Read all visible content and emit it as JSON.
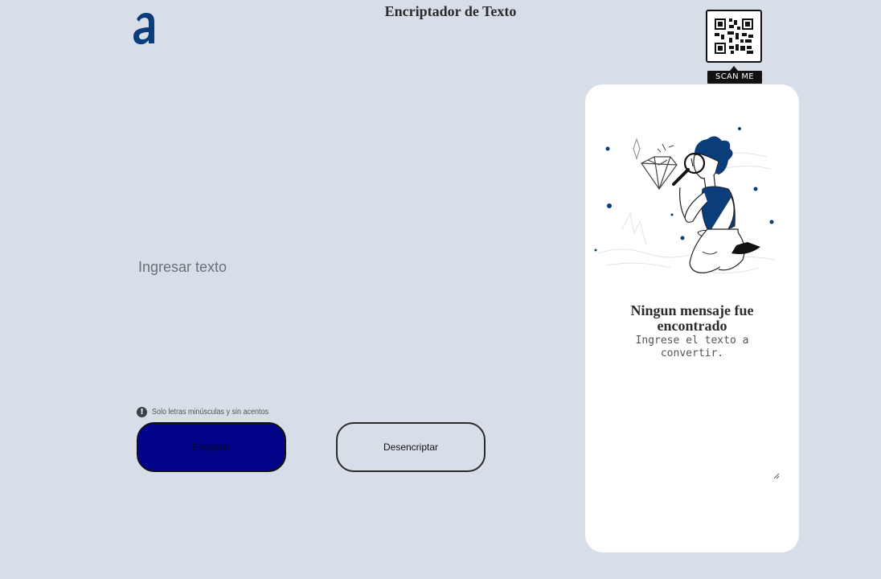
{
  "header": {
    "title": "Encriptador de Texto",
    "logo_icon": "alura-a-logo-icon",
    "logo_color": "#0a3d7a"
  },
  "qr": {
    "label": "SCAN ME",
    "icon": "qr-code-icon"
  },
  "editor": {
    "placeholder": "Ingresar texto",
    "value": ""
  },
  "hint": {
    "icon": "exclamation-circle-icon",
    "text": "Solo letras minúsculas y sin acentos"
  },
  "buttons": {
    "encrypt_label": "Encriptar",
    "decrypt_label": "Desencriptar",
    "encrypt_color": "#03038a"
  },
  "output": {
    "illustration_icon": "person-magnifying-glass-illustration",
    "title": "Ningun mensaje fue encontrado",
    "subtitle": "Ingrese el texto a convertir.",
    "accent_color": "#0a3d7a"
  }
}
